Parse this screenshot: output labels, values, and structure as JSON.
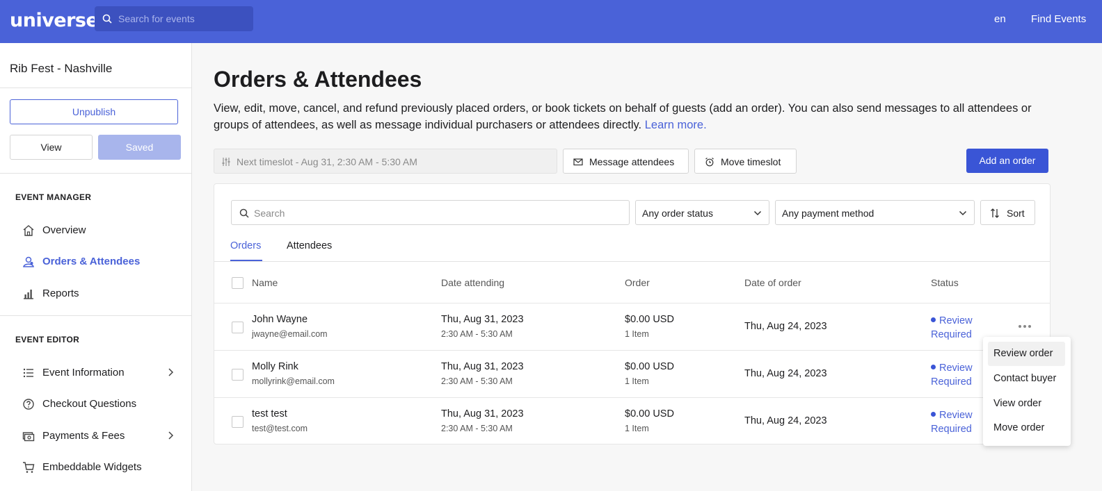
{
  "topbar": {
    "logo": "universe",
    "search_placeholder": "Search for events",
    "lang": "en",
    "find_events": "Find Events"
  },
  "sidebar": {
    "event_title": "Rib Fest - Nashville",
    "unpublish": "Unpublish",
    "view": "View",
    "saved": "Saved",
    "manager_heading": "EVENT MANAGER",
    "manager_items": [
      {
        "label": "Overview",
        "icon": "home-icon"
      },
      {
        "label": "Orders & Attendees",
        "icon": "attendees-icon",
        "active": true
      },
      {
        "label": "Reports",
        "icon": "bar-chart-icon"
      }
    ],
    "editor_heading": "EVENT EDITOR",
    "editor_items": [
      {
        "label": "Event Information",
        "icon": "list-icon",
        "has_chevron": true
      },
      {
        "label": "Checkout Questions",
        "icon": "question-icon"
      },
      {
        "label": "Payments & Fees",
        "icon": "money-icon",
        "has_chevron": true
      },
      {
        "label": "Embeddable Widgets",
        "icon": "cart-icon"
      }
    ]
  },
  "main": {
    "title": "Orders & Attendees",
    "description": "View, edit, move, cancel, and refund previously placed orders, or book tickets on behalf of guests (add an order). You can also send messages to all attendees or groups of attendees, as well as message individual purchasers or attendees directly.",
    "learn_more": "Learn more.",
    "timeslot": "Next timeslot - Aug 31, 2:30 AM - 5:30 AM",
    "message_attendees": "Message attendees",
    "move_timeslot": "Move timeslot",
    "add_order": "Add an order",
    "search_placeholder": "Search",
    "order_status": "Any order status",
    "payment_method": "Any payment method",
    "sort": "Sort",
    "tabs": [
      "Orders",
      "Attendees"
    ],
    "columns": [
      "Name",
      "Date attending",
      "Order",
      "Date of order",
      "Status"
    ],
    "rows": [
      {
        "name": "John Wayne",
        "email": "jwayne@email.com",
        "date": "Thu, Aug 31, 2023",
        "time": "2:30 AM - 5:30 AM",
        "amount": "$0.00 USD",
        "items": "1 Item",
        "order_date": "Thu, Aug 24, 2023",
        "status": "Review Required"
      },
      {
        "name": "Molly Rink",
        "email": "mollyrink@email.com",
        "date": "Thu, Aug 31, 2023",
        "time": "2:30 AM - 5:30 AM",
        "amount": "$0.00 USD",
        "items": "1 Item",
        "order_date": "Thu, Aug 24, 2023",
        "status": "Review Required"
      },
      {
        "name": "test test",
        "email": "test@test.com",
        "date": "Thu, Aug 31, 2023",
        "time": "2:30 AM - 5:30 AM",
        "amount": "$0.00 USD",
        "items": "1 Item",
        "order_date": "Thu, Aug 24, 2023",
        "status": "Review Required"
      }
    ],
    "context_menu": [
      "Review order",
      "Contact buyer",
      "View order",
      "Move order"
    ]
  },
  "colors": {
    "brand": "#4a62d8",
    "primary_button": "#3a55d6",
    "saved_button": "#a8b5ec"
  }
}
